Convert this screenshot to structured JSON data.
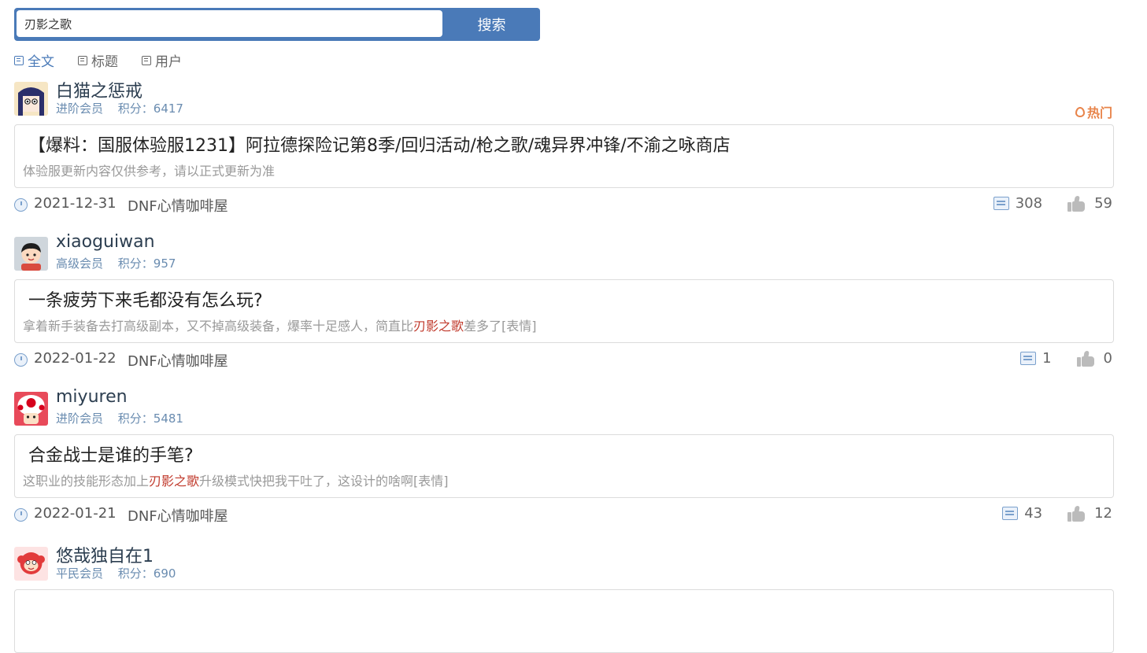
{
  "search": {
    "value": "刃影之歌",
    "button_label": "搜索"
  },
  "tabs": [
    {
      "label": "全文",
      "active": true
    },
    {
      "label": "标题",
      "active": false
    },
    {
      "label": "用户",
      "active": false
    }
  ],
  "posts": [
    {
      "username": "白猫之惩戒",
      "level": "进阶会员",
      "points": "积分：6417",
      "hot_label": "热门",
      "title": "【爆料：国服体验服1231】阿拉德探险记第8季/回归活动/枪之歌/魂异界冲锋/不渝之咏商店",
      "desc_before": "体验服更新内容仅供参考，请以正式更新为准",
      "desc_highlight": "",
      "desc_after": "",
      "date": "2021-12-31",
      "forum": "DNF心情咖啡屋",
      "comments": "308",
      "likes": "59"
    },
    {
      "username": "xiaoguiwan",
      "level": "高级会员",
      "points": "积分：957",
      "title": "一条疲劳下来毛都没有怎么玩?",
      "desc_before": "拿着新手装备去打高级副本，又不掉高级装备，爆率十足感人，简直比",
      "desc_highlight": "刃影之歌",
      "desc_after": "差多了[表情]",
      "date": "2022-01-22",
      "forum": "DNF心情咖啡屋",
      "comments": "1",
      "likes": "0"
    },
    {
      "username": "miyuren",
      "level": "进阶会员",
      "points": "积分：5481",
      "title": "合金战士是谁的手笔?",
      "desc_before": "这职业的技能形态加上",
      "desc_highlight": "刃影之歌",
      "desc_after": "升级模式快把我干吐了，这设计的啥啊[表情]",
      "date": "2022-01-21",
      "forum": "DNF心情咖啡屋",
      "comments": "43",
      "likes": "12"
    },
    {
      "username": "悠哉独自在1",
      "level": "平民会员",
      "points": "积分：690"
    }
  ],
  "colors": {
    "accent": "#4a7ab8",
    "highlight": "#c0392b",
    "hot": "#e8844a"
  }
}
